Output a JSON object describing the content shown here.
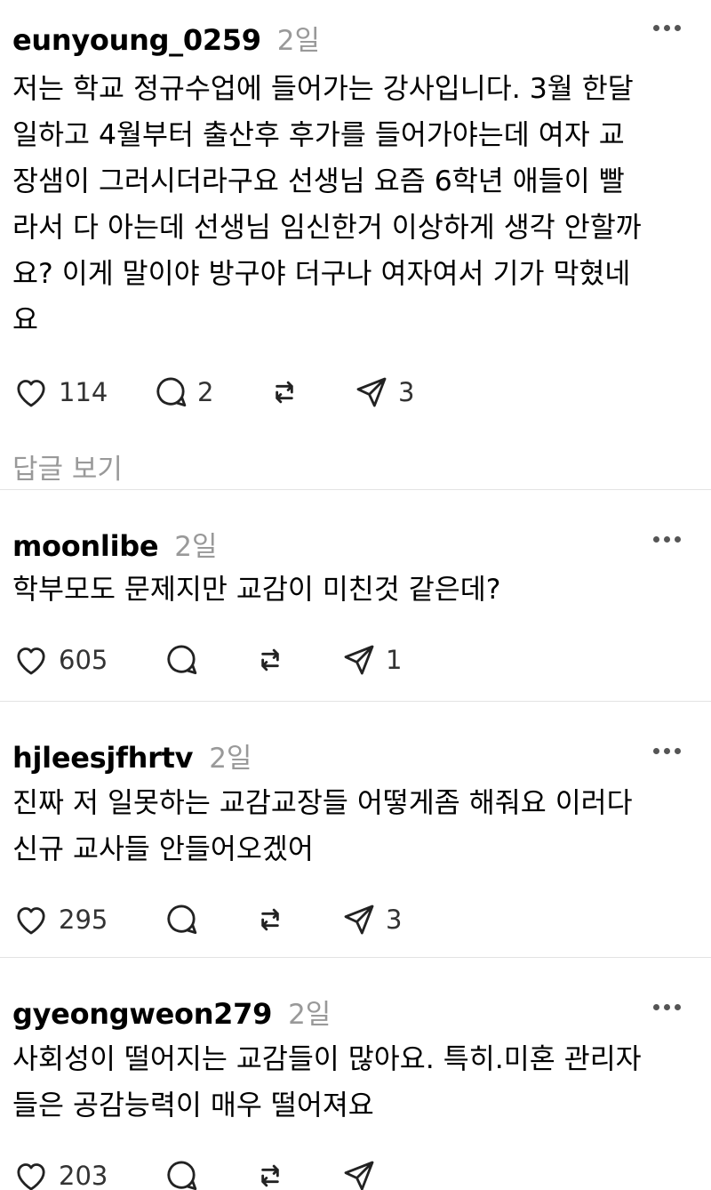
{
  "posts": [
    {
      "username": "eunyoung_0259",
      "time": "2일",
      "text": "저는 학교 정규수업에 들어가는 강사입니다. 3월 한달\n일하고 4월부터 출산후 후가를 들어가야는데 여자 교\n장샘이 그러시더라구요 선생님 요즘 6학년 애들이 빨\n라서 다 아는데 선생님 임신한거 이상하게 생각 안할까\n요? 이게 말이야 방구야 더구나 여자여서 기가 막혔네\n요",
      "likes": "114",
      "comments": "2",
      "reposts": "",
      "shares": "3",
      "replies_label": "답글 보기"
    },
    {
      "username": "moonlibe",
      "time": "2일",
      "text": "학부모도 문제지만 교감이 미친것 같은데?",
      "likes": "605",
      "comments": "",
      "reposts": "",
      "shares": "1"
    },
    {
      "username": "hjleesjfhrtv",
      "time": "2일",
      "text": "진짜 저 일못하는 교감교장들 어떻게좀 해줘요 이러다\n신규 교사들 안들어오겠어",
      "likes": "295",
      "comments": "",
      "reposts": "",
      "shares": "3"
    },
    {
      "username": "gyeongweon279",
      "time": "2일",
      "text": "사회성이 떨어지는 교감들이 많아요. 특히.미혼 관리자\n들은 공감능력이 매우 떨어져요",
      "likes": "203",
      "comments": "",
      "reposts": "",
      "shares": ""
    }
  ],
  "icons": {
    "like": "heart-icon",
    "comment": "comment-bubble-icon",
    "repost": "repost-icon",
    "share": "send-icon",
    "more": "more-dots-icon"
  }
}
